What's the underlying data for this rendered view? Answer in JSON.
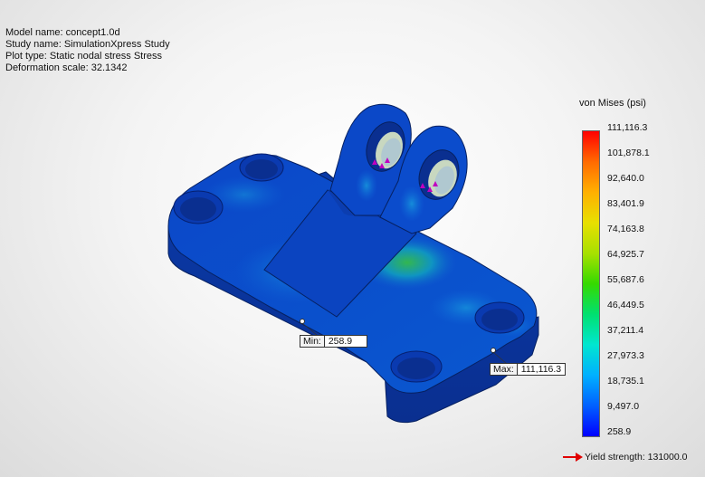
{
  "info": {
    "model_name": "Model name: concept1.0d",
    "study_name": "Study name: SimulationXpress Study",
    "plot_type": "Plot type: Static nodal stress Stress",
    "deformation_scale": "Deformation scale: 32.1342"
  },
  "probes": {
    "min_label": "Min:",
    "min_value": "258.9",
    "max_label": "Max:",
    "max_value": "111,116.3"
  },
  "legend": {
    "title": "von Mises (psi)",
    "ticks": [
      "111,116.3",
      "101,878.1",
      "92,640.0",
      "83,401.9",
      "74,163.8",
      "64,925.7",
      "55,687.6",
      "46,449.5",
      "37,211.4",
      "27,973.3",
      "18,735.1",
      "9,497.0",
      "258.9"
    ],
    "yield_text": "Yield strength: 131000.0",
    "colors": {
      "max": "#ff0000",
      "min": "#0000ff",
      "yield_arrow": "#e00000"
    }
  }
}
